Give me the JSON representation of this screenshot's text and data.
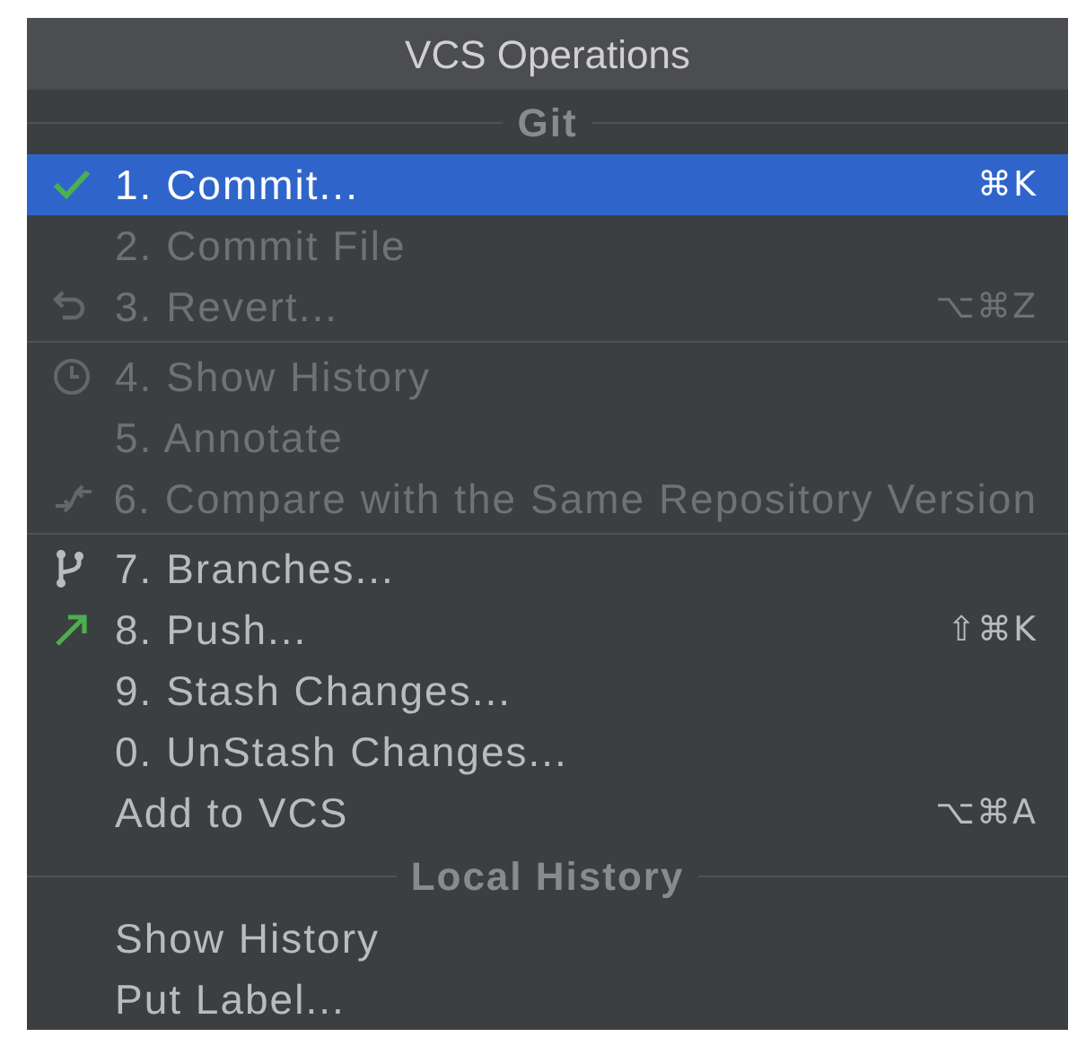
{
  "popup": {
    "title": "VCS Operations"
  },
  "sections": [
    {
      "title": "Git",
      "groups": [
        [
          {
            "label": "1. Commit...",
            "shortcut": "⌘K",
            "selected": true,
            "disabled": false
          },
          {
            "label": "2. Commit File",
            "selected": false,
            "disabled": true
          },
          {
            "label": "3. Revert...",
            "shortcut": "⌥⌘Z",
            "selected": false,
            "disabled": true
          }
        ],
        [
          {
            "label": "4. Show History",
            "selected": false,
            "disabled": true
          },
          {
            "label": "5. Annotate",
            "selected": false,
            "disabled": true
          },
          {
            "label": "6. Compare with the Same Repository Version",
            "selected": false,
            "disabled": true
          }
        ],
        [
          {
            "label": "7. Branches...",
            "selected": false,
            "disabled": false
          },
          {
            "label": "8. Push...",
            "shortcut": "⇧⌘K",
            "selected": false,
            "disabled": false
          },
          {
            "label": "9. Stash Changes...",
            "selected": false,
            "disabled": false
          },
          {
            "label": "0. UnStash Changes...",
            "selected": false,
            "disabled": false
          },
          {
            "label": "Add to VCS",
            "shortcut": "⌥⌘A",
            "selected": false,
            "disabled": false
          }
        ]
      ]
    },
    {
      "title": "Local History",
      "groups": [
        [
          {
            "label": "Show History",
            "selected": false,
            "disabled": false
          },
          {
            "label": "Put Label...",
            "selected": false,
            "disabled": false
          }
        ]
      ]
    }
  ]
}
